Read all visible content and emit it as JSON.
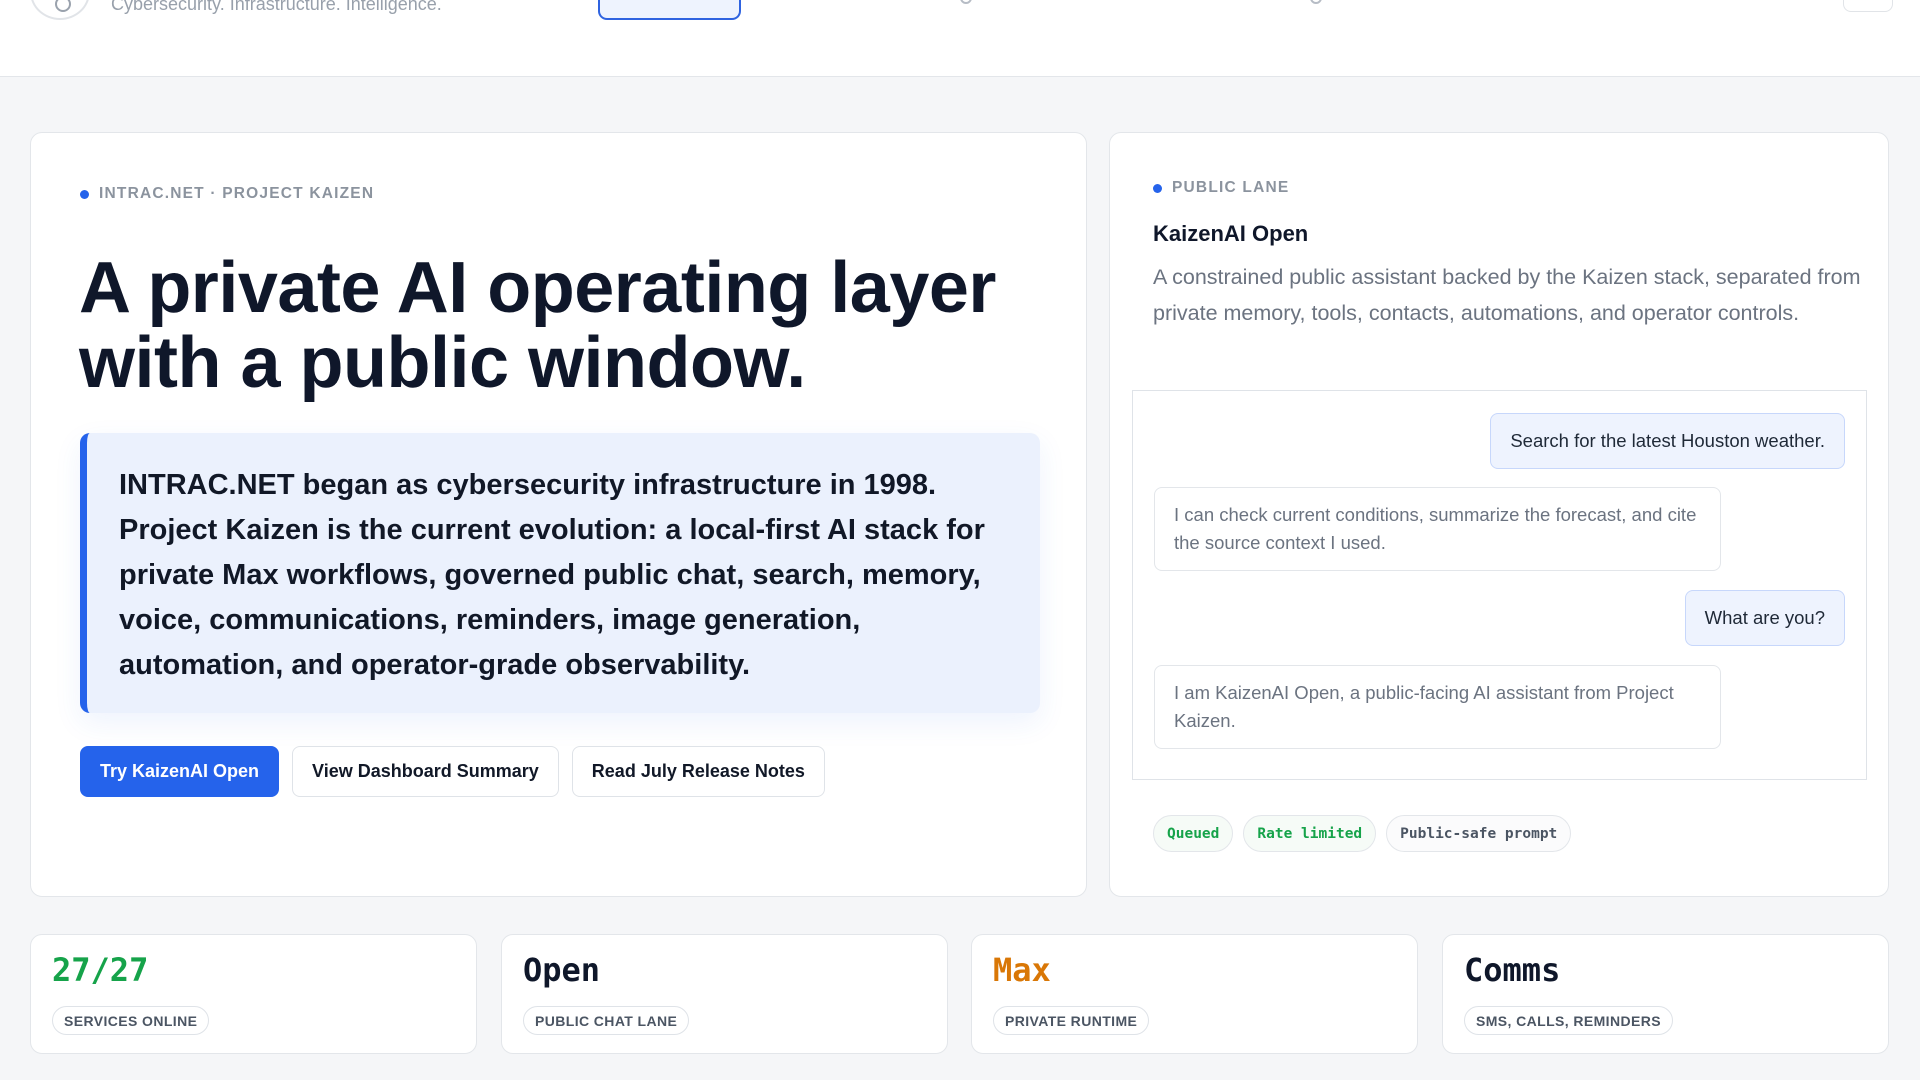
{
  "header": {
    "tagline": "Cybersecurity. Infrastructure. Intelligence."
  },
  "hero": {
    "eyebrow": "INTRAC.NET · PROJECT KAIZEN",
    "title": "A private AI operating layer with a public window.",
    "callout": "INTRAC.NET began as cybersecurity infrastructure in 1998. Project Kaizen is the current evolution: a local-first AI stack for private Max workflows, governed public chat, search, memory, voice, communications, reminders, image generation, automation, and operator-grade observability.",
    "actions": [
      {
        "label": "Try KaizenAI Open"
      },
      {
        "label": "View Dashboard Summary"
      },
      {
        "label": "Read July Release Notes"
      }
    ]
  },
  "lane": {
    "eyebrow": "PUBLIC LANE",
    "title": "KaizenAI Open",
    "description": "A constrained public assistant backed by the Kaizen stack, separated from private memory, tools, contacts, automations, and operator controls.",
    "messages": [
      {
        "role": "user",
        "text": "Search for the latest Houston weather."
      },
      {
        "role": "assistant",
        "text": "I can check current conditions, summarize the forecast, and cite the source context I used."
      },
      {
        "role": "user",
        "text": "What are you?"
      },
      {
        "role": "assistant",
        "text": "I am KaizenAI Open, a public-facing AI assistant from Project Kaizen."
      }
    ],
    "pills": [
      "Queued",
      "Rate limited",
      "Public-safe prompt"
    ]
  },
  "stats": [
    {
      "value": "27/27",
      "label": "SERVICES ONLINE",
      "color": "#16a34a"
    },
    {
      "value": "Open",
      "label": "PUBLIC CHAT LANE",
      "color": "#0f172a"
    },
    {
      "value": "Max",
      "label": "PRIVATE RUNTIME",
      "color": "#d97706"
    },
    {
      "value": "Comms",
      "label": "SMS, CALLS, REMINDERS",
      "color": "#0f172a"
    }
  ],
  "colors": {
    "accent": "#2563eb",
    "success": "#16a34a",
    "warning": "#d97706"
  }
}
